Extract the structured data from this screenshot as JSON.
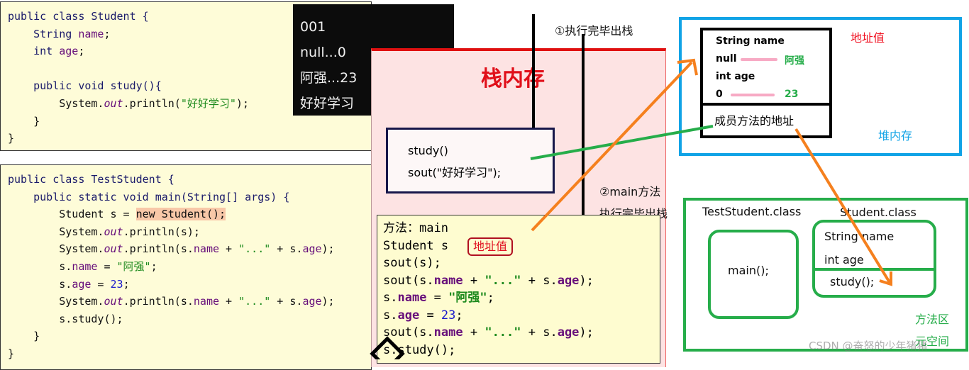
{
  "student_code": [
    [
      [
        "public class Student {",
        "k"
      ]
    ],
    [
      [
        "    String ",
        "k"
      ],
      [
        "name",
        "f"
      ],
      [
        ";",
        ""
      ]
    ],
    [
      [
        "    int ",
        "k"
      ],
      [
        "age",
        "f"
      ],
      [
        ";",
        ""
      ]
    ],
    [
      [
        "",
        ""
      ]
    ],
    [
      [
        "    public void study(){",
        "k"
      ]
    ],
    [
      [
        "        System.",
        ""
      ],
      [
        "out",
        "i"
      ],
      [
        ".println(",
        ""
      ],
      [
        "\"好好学习\"",
        "s"
      ],
      [
        ");",
        ""
      ]
    ],
    [
      [
        "    }",
        ""
      ]
    ],
    [
      [
        "}",
        ""
      ]
    ]
  ],
  "test_code": [
    [
      [
        "public class TestStudent {",
        "k"
      ]
    ],
    [
      [
        "    public static void main(String[] args) {",
        "k"
      ]
    ],
    [
      [
        "        Student s = ",
        ""
      ],
      [
        "new Student();",
        "hl"
      ]
    ],
    [
      [
        "        System.",
        ""
      ],
      [
        "out",
        "i"
      ],
      [
        ".println(s);",
        ""
      ]
    ],
    [
      [
        "        System.",
        ""
      ],
      [
        "out",
        "i"
      ],
      [
        ".println(s.",
        ""
      ],
      [
        "name",
        "f"
      ],
      [
        " + ",
        ""
      ],
      [
        "\"...\"",
        "s"
      ],
      [
        " + s.",
        ""
      ],
      [
        "age",
        "f"
      ],
      [
        ");",
        ""
      ]
    ],
    [
      [
        "        s.",
        ""
      ],
      [
        "name",
        "f"
      ],
      [
        " = ",
        ""
      ],
      [
        "\"阿强\"",
        "s"
      ],
      [
        ";",
        ""
      ]
    ],
    [
      [
        "        s.",
        ""
      ],
      [
        "age",
        "f"
      ],
      [
        " = ",
        ""
      ],
      [
        "23",
        "n"
      ],
      [
        ";",
        ""
      ]
    ],
    [
      [
        "        System.",
        ""
      ],
      [
        "out",
        "i"
      ],
      [
        ".println(s.",
        ""
      ],
      [
        "name",
        "f"
      ],
      [
        " + ",
        ""
      ],
      [
        "\"...\"",
        "s"
      ],
      [
        " + s.",
        ""
      ],
      [
        "age",
        "f"
      ],
      [
        ");",
        ""
      ]
    ],
    [
      [
        "        s.study();",
        ""
      ]
    ],
    [
      [
        "    }",
        ""
      ]
    ],
    [
      [
        "}",
        ""
      ]
    ]
  ],
  "console": {
    "lines": [
      "001",
      "null...0",
      "阿强...23",
      "好好学习"
    ]
  },
  "stack": {
    "title": "栈内存",
    "note1": "①执行完毕出栈",
    "note2a": "②main方法",
    "note2b": "执行完毕出栈",
    "study_frame": [
      "study()",
      "sout(\"好好学习\");"
    ],
    "main_frame": {
      "lines": [
        [
          [
            "方法：main",
            ""
          ]
        ],
        [
          [
            "Student s  ",
            ""
          ]
        ],
        [
          [
            "sout(s);",
            ""
          ]
        ],
        [
          [
            "sout(s.",
            ""
          ],
          [
            "name",
            "f"
          ],
          [
            " + ",
            ""
          ],
          [
            "\"...\"",
            "s"
          ],
          [
            " + s.",
            ""
          ],
          [
            "age",
            "f"
          ],
          [
            ");",
            ""
          ]
        ],
        [
          [
            "s.",
            ""
          ],
          [
            "name",
            "f"
          ],
          [
            " = ",
            ""
          ],
          [
            "\"阿强\"",
            "s"
          ],
          [
            ";",
            ""
          ]
        ],
        [
          [
            "s.",
            ""
          ],
          [
            "age",
            "f"
          ],
          [
            " = ",
            ""
          ],
          [
            "23",
            "n"
          ],
          [
            ";",
            ""
          ]
        ],
        [
          [
            "sout(s.",
            ""
          ],
          [
            "name",
            "f"
          ],
          [
            " + ",
            ""
          ],
          [
            "\"...\"",
            "s"
          ],
          [
            " + s.",
            ""
          ],
          [
            "age",
            "f"
          ],
          [
            ");",
            ""
          ]
        ],
        [
          [
            "s.study();",
            ""
          ]
        ]
      ],
      "address_badge": "地址值"
    }
  },
  "heap": {
    "title": "堆内存",
    "address_label": "地址值",
    "field1": "String name",
    "field1_old": "null",
    "field1_new": "阿强",
    "field2": "int age",
    "field2_old": "0",
    "field2_new": "23",
    "methods": "成员方法的地址"
  },
  "method_area": {
    "title": "方法区",
    "subtitle": "元空间",
    "class1": "TestStudent.class",
    "class1_method": "main();",
    "class2": "Student.class",
    "class2_fields": [
      "String name",
      "int age"
    ],
    "class2_method": "study();"
  },
  "watermark": "CSDN @奋怒的少年猪猪",
  "colors": {
    "stack_border": "#e01010",
    "heap_border": "#11a3e6",
    "method_area_border": "#26ad4a",
    "arrow_orange": "#f5801e",
    "arrow_green": "#26ad4a"
  }
}
